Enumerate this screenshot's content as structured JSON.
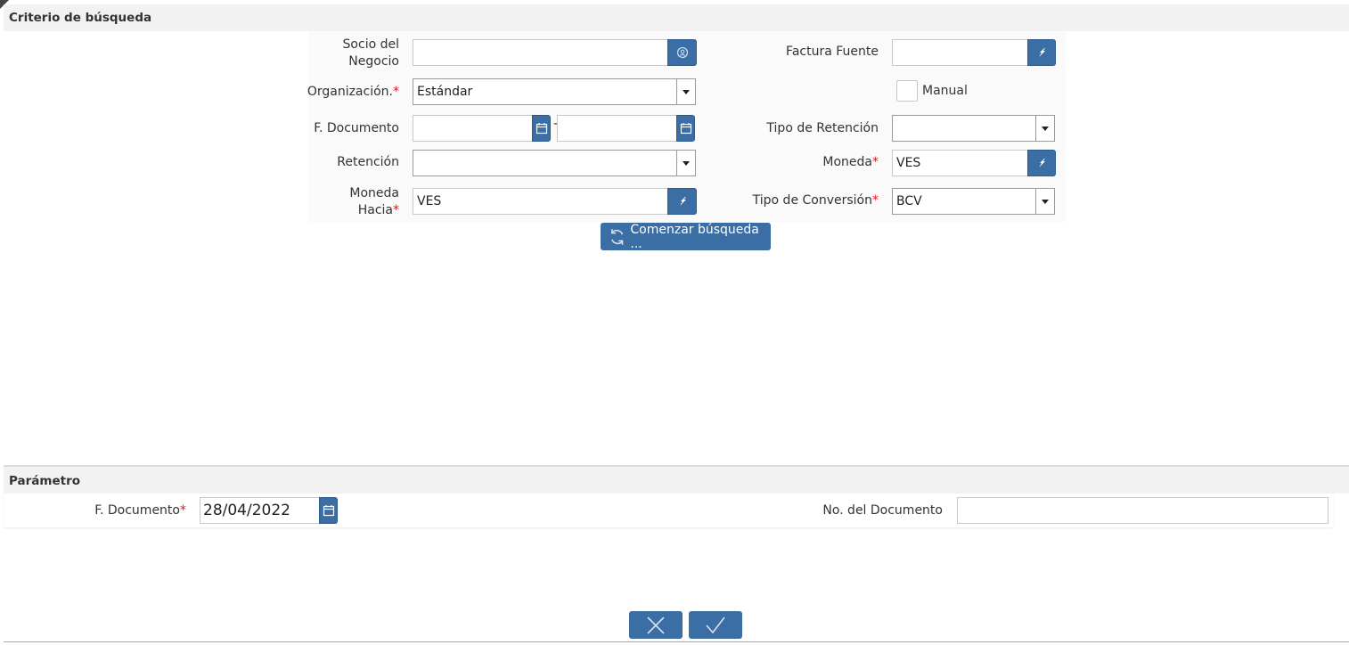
{
  "search_section": {
    "title": "Criterio de búsqueda",
    "business_partner": {
      "label_line1": "Socio del",
      "label_line2": "Negocio",
      "value": ""
    },
    "source_invoice": {
      "label": "Factura Fuente",
      "value": ""
    },
    "organization": {
      "label": "Organización.",
      "required_mark": "*",
      "value": "Estándar"
    },
    "manual": {
      "label": "Manual",
      "checked": false
    },
    "doc_date": {
      "label": "F. Documento",
      "from": "",
      "separator": "-",
      "to": ""
    },
    "withholding_type": {
      "label": "Tipo de Retención",
      "value": ""
    },
    "withholding": {
      "label": "Retención",
      "value": ""
    },
    "currency": {
      "label": "Moneda",
      "required_mark": "*",
      "value": "VES"
    },
    "currency_to": {
      "label_line1": "Moneda",
      "label_line2": "Hacia",
      "required_mark": "*",
      "value": "VES"
    },
    "conversion_type": {
      "label": "Tipo de Conversión",
      "required_mark": "*",
      "value": "BCV"
    },
    "search_button": "Comenzar búsqueda ..."
  },
  "parameter_section": {
    "title": "Parámetro",
    "doc_date": {
      "label": "F. Documento",
      "required_mark": "*",
      "value": "28/04/2022"
    },
    "doc_number": {
      "label": "No. del Documento",
      "value": ""
    }
  },
  "colors": {
    "accent": "#3a6ea5",
    "required": "#e0141e",
    "header_bg": "#f2f2f2"
  },
  "icons": [
    "search-partner-icon",
    "zoom-icon",
    "calendar-icon",
    "dropdown-arrow-icon",
    "refresh-icon",
    "cancel-icon",
    "ok-icon"
  ]
}
